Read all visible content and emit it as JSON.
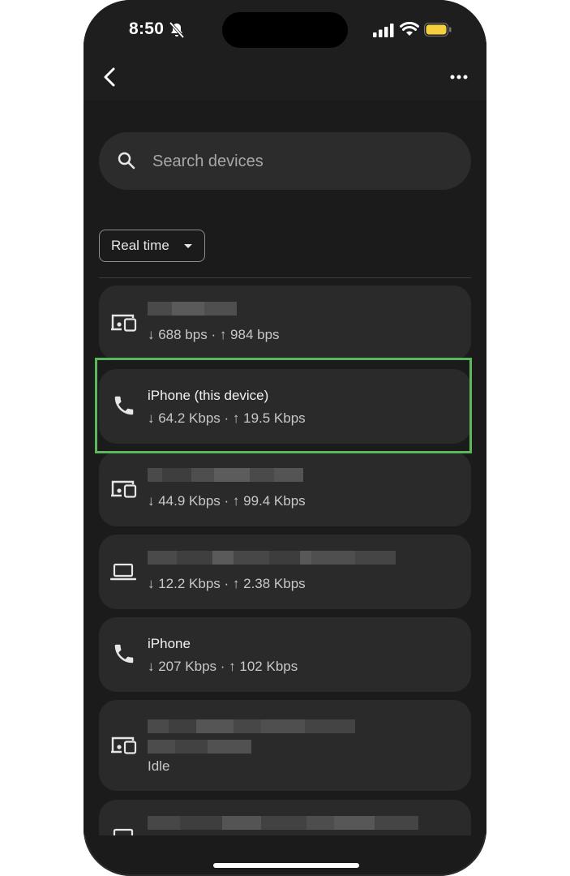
{
  "status_bar": {
    "time": "8:50"
  },
  "search": {
    "placeholder": "Search devices"
  },
  "filter": {
    "label": "Real time"
  },
  "devices": [
    {
      "name": "",
      "stats": "↓ 688 bps · ↑ 984 bps",
      "icon": "devices-icon"
    },
    {
      "name": "iPhone (this device)",
      "stats": "↓ 64.2 Kbps · ↑ 19.5 Kbps",
      "icon": "phone-icon"
    },
    {
      "name": "",
      "stats": "↓ 44.9 Kbps · ↑ 99.4 Kbps",
      "icon": "devices-icon"
    },
    {
      "name": "",
      "stats": "↓ 12.2 Kbps · ↑ 2.38 Kbps",
      "icon": "laptop-icon"
    },
    {
      "name": "iPhone",
      "stats": "↓ 207 Kbps · ↑ 102 Kbps",
      "icon": "phone-icon"
    },
    {
      "name": "",
      "stats": "Idle",
      "icon": "devices-icon"
    },
    {
      "name": "",
      "stats": "",
      "icon": "laptop-icon"
    }
  ],
  "colors": {
    "background": "#1b1b1b",
    "card": "#2a2a2a",
    "highlight": "#5cb85c"
  }
}
